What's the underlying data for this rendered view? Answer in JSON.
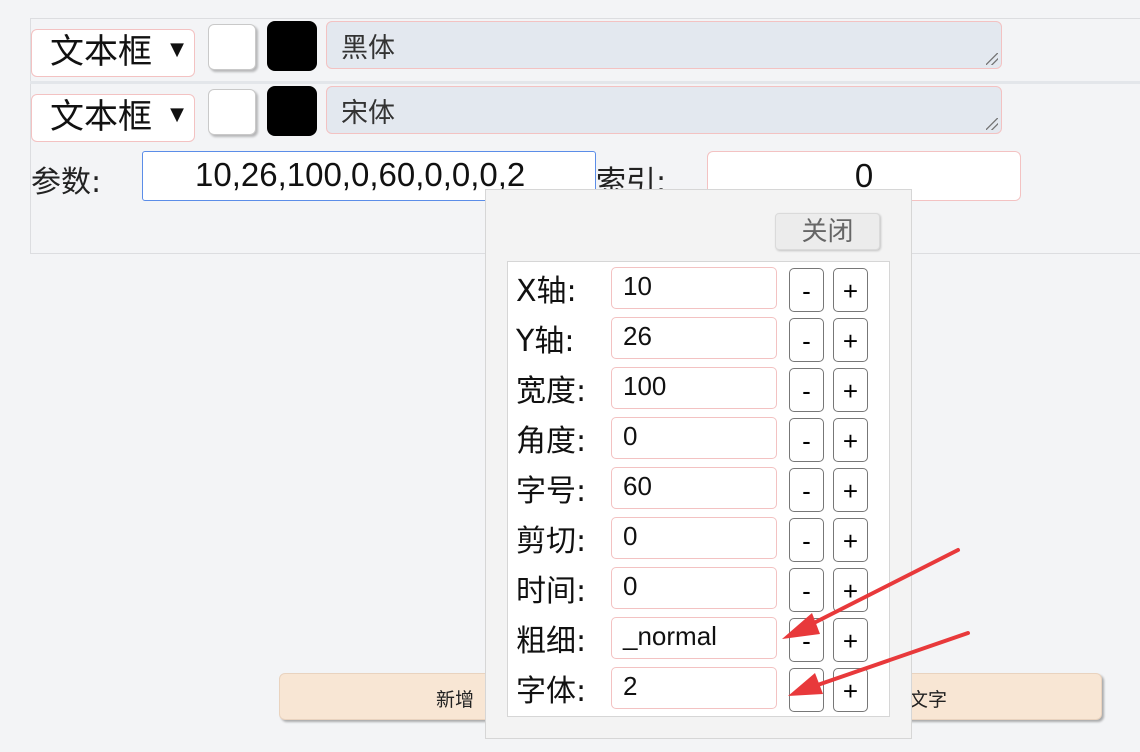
{
  "rows": [
    {
      "type_label": "文本框",
      "font_name": "黑体",
      "color": "#000000"
    },
    {
      "type_label": "文本框",
      "font_name": "宋体",
      "color": "#000000"
    }
  ],
  "params": {
    "label": "参数:",
    "value": "10,26,100,0,60,0,0,0,2"
  },
  "index": {
    "label": "索引:",
    "value": "0"
  },
  "bottom_button": {
    "left_text": "新增",
    "right_text": "文字"
  },
  "popup": {
    "close_label": "关闭",
    "fields": [
      {
        "label": "X轴:",
        "value": "10"
      },
      {
        "label": "Y轴:",
        "value": "26"
      },
      {
        "label": "宽度:",
        "value": "100"
      },
      {
        "label": "角度:",
        "value": "0"
      },
      {
        "label": "字号:",
        "value": "60"
      },
      {
        "label": "剪切:",
        "value": "0"
      },
      {
        "label": "时间:",
        "value": "0"
      },
      {
        "label": "粗细:",
        "value": "_normal"
      },
      {
        "label": "字体:",
        "value": "2"
      }
    ],
    "minus": "-",
    "plus": "+"
  },
  "annotation_color": "#e8393b"
}
